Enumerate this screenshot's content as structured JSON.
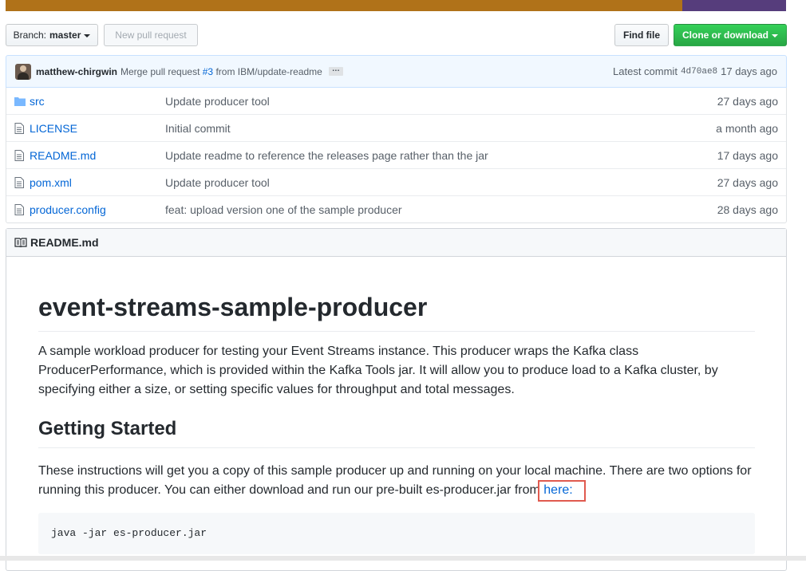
{
  "language_bar": {
    "colors": [
      "#b07219",
      "#563d7c"
    ]
  },
  "toolbar": {
    "branch_prefix": "Branch:",
    "branch_name": "master",
    "new_pr_label": "New pull request",
    "find_file_label": "Find file",
    "clone_label": "Clone or download"
  },
  "commit": {
    "author": "matthew-chirgwin",
    "message_prefix": "Merge pull request",
    "pr_link": "#3",
    "message_suffix": "from IBM/update-readme",
    "ellipsis": "…",
    "latest_label": "Latest commit",
    "sha": "4d70ae8",
    "age": "17 days ago"
  },
  "files": [
    {
      "icon": "folder-icon",
      "name": "src",
      "message": "Update producer tool",
      "age": "27 days ago"
    },
    {
      "icon": "file-icon",
      "name": "LICENSE",
      "message": "Initial commit",
      "age": "a month ago"
    },
    {
      "icon": "file-icon",
      "name": "README.md",
      "message": "Update readme to reference the releases page rather than the jar",
      "age": "17 days ago"
    },
    {
      "icon": "file-icon",
      "name": "pom.xml",
      "message": "Update producer tool",
      "age": "27 days ago"
    },
    {
      "icon": "file-icon",
      "name": "producer.config",
      "message": "feat: upload version one of the sample producer",
      "age": "28 days ago"
    }
  ],
  "readme": {
    "header": "README.md",
    "title": "event-streams-sample-producer",
    "intro": "A sample workload producer for testing your Event Streams instance. This producer wraps the Kafka class ProducerPerformance, which is provided within the Kafka Tools jar. It will allow you to produce load to a Kafka cluster, by specifying either a size, or setting specific values for throughput and total messages.",
    "section_title": "Getting Started",
    "section_text": "These instructions will get you a copy of this sample producer up and running on your local machine. There are two options for running this producer. You can either download and run our pre-built es-producer.jar from",
    "section_link": "here:",
    "code": "java -jar es-producer.jar"
  }
}
